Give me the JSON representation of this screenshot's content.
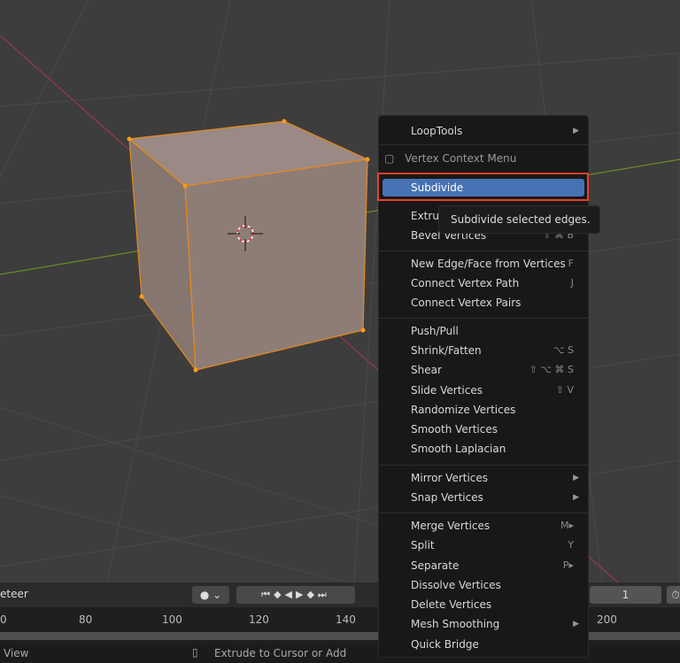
{
  "menu": {
    "items": [
      {
        "label": "LoopTools",
        "submenu": true
      },
      {
        "label": "Vertex Context Menu",
        "title": true,
        "icon": "vertex-menu-icon"
      },
      {
        "label": "Subdivide",
        "highlighted": true
      },
      {
        "label": "Extrude Vertices"
      },
      {
        "label": "Bevel Vertices",
        "shortcut": "⇧ ⌘ B"
      },
      {
        "label": "New Edge/Face from Vertices",
        "shortcut": "F"
      },
      {
        "label": "Connect Vertex Path",
        "shortcut": "J"
      },
      {
        "label": "Connect Vertex Pairs"
      },
      {
        "label": "Push/Pull"
      },
      {
        "label": "Shrink/Fatten",
        "shortcut": "⌥ S"
      },
      {
        "label": "Shear",
        "shortcut": "⇧ ⌥ ⌘ S"
      },
      {
        "label": "Slide Vertices",
        "shortcut": "⇧ V"
      },
      {
        "label": "Randomize Vertices"
      },
      {
        "label": "Smooth Vertices"
      },
      {
        "label": "Smooth Laplacian"
      },
      {
        "label": "Mirror Vertices",
        "submenu": true
      },
      {
        "label": "Snap Vertices",
        "submenu": true
      },
      {
        "label": "Merge Vertices",
        "shortcut": "M▸"
      },
      {
        "label": "Split",
        "shortcut": "Y"
      },
      {
        "label": "Separate",
        "shortcut": "P▸"
      },
      {
        "label": "Dissolve Vertices"
      },
      {
        "label": "Delete Vertices"
      },
      {
        "label": "Mesh Smoothing",
        "submenu": true
      },
      {
        "label": "Quick Bridge"
      }
    ]
  },
  "tooltip": "Subdivide selected edges.",
  "timeline": {
    "mode_label": "eteer",
    "current_frame": "1",
    "ticks": [
      "0",
      "80",
      "100",
      "120",
      "140",
      "200"
    ]
  },
  "status": {
    "left": "View",
    "middle": "Extrude to Cursor or Add"
  },
  "colors": {
    "highlight": "#4772b3",
    "annotation": "#e8402a"
  }
}
